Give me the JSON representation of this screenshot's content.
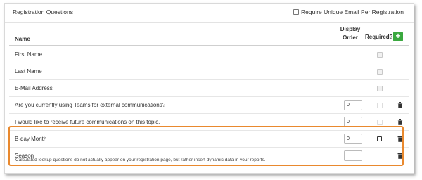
{
  "panel": {
    "title": "Registration Questions",
    "unique_email_label": "Require Unique Email Per Registration"
  },
  "columns": {
    "name": "Name",
    "display_order_line1": "Display",
    "display_order_line2": "Order",
    "required": "Required?"
  },
  "add_button_label": "+",
  "questions": [
    {
      "label": "First Name",
      "order": "",
      "required": "disabled-checked"
    },
    {
      "label": "Last Name",
      "order": "",
      "required": "disabled-checked"
    },
    {
      "label": "E-Mail Address",
      "order": "",
      "required": "disabled-checked"
    },
    {
      "label": "Are you currently using Teams for external communications?",
      "order": "0",
      "required": "disabled"
    },
    {
      "label": "I would like to receive future communications on this topic.",
      "order": "0",
      "required": "disabled"
    },
    {
      "label": "B-day Month",
      "order": "0",
      "required": "enabled"
    },
    {
      "label": "Season",
      "order": "",
      "required": "none"
    }
  ],
  "note": "Calculated lookup questions do not actually appear on your registration page, but rather insert dynamic data in your reports.",
  "colors": {
    "add_button": "#3aa83f",
    "highlight": "#e9892e"
  }
}
